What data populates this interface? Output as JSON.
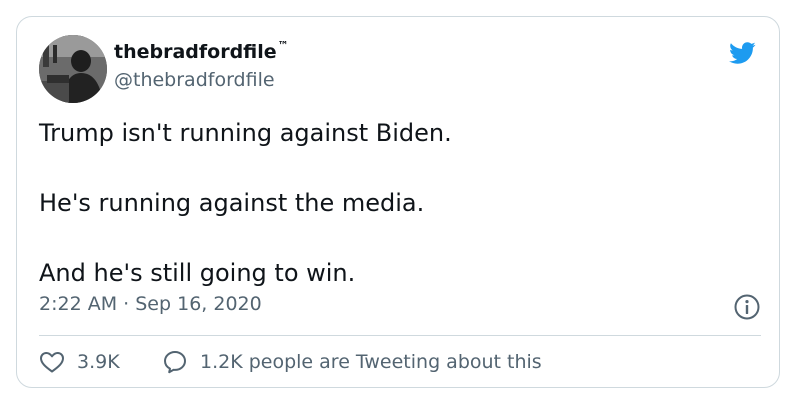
{
  "tweet": {
    "display_name": "thebradfordfile",
    "trademark": "™",
    "handle": "@thebradfordfile",
    "paragraphs": [
      "Trump isn't running against Biden.",
      "He's running against the media.",
      "And he's still going to win."
    ],
    "time": "2:22 AM",
    "separator": "·",
    "date": "Sep 16, 2020",
    "likes": "3.9K",
    "conversation": "1.2K people are Tweeting about this"
  },
  "icons": {
    "brand": "twitter-bird-icon",
    "info": "info-icon",
    "like": "heart-icon",
    "reply": "speech-bubble-icon"
  },
  "colors": {
    "brand_blue": "#1d9bf0",
    "text_primary": "#0f1419",
    "text_secondary": "#536471",
    "border": "#cfd9de"
  }
}
